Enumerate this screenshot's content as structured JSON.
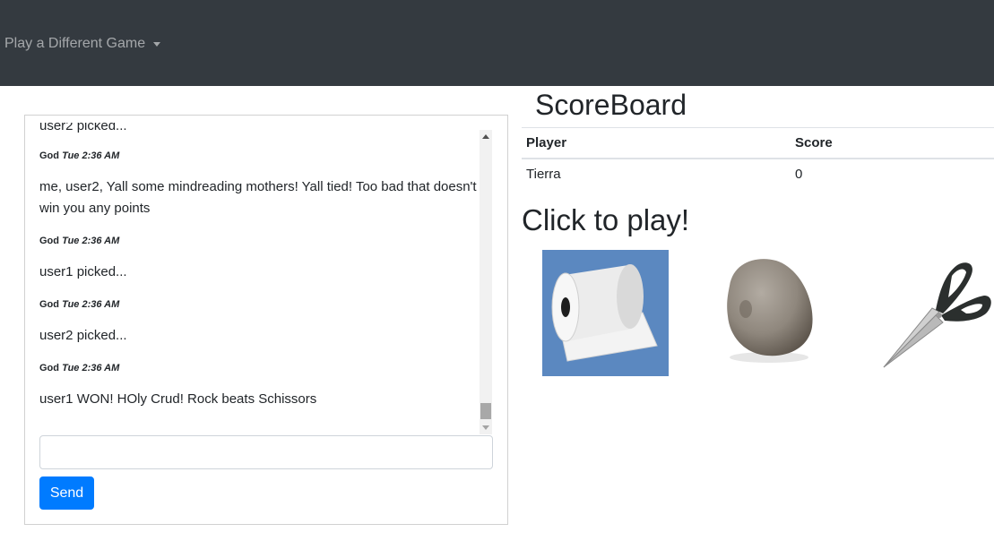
{
  "navbar": {
    "dropdown_label": "Play a Different Game"
  },
  "chat": {
    "messages": [
      {
        "type": "text",
        "text": "user2 picked..."
      },
      {
        "type": "meta",
        "author": "God",
        "time": "Tue 2:36 AM"
      },
      {
        "type": "text",
        "text": "me, user2, Yall some mindreading mothers! Yall tied! Too bad that doesn't win you any points"
      },
      {
        "type": "meta",
        "author": "God",
        "time": "Tue 2:36 AM"
      },
      {
        "type": "text",
        "text": "user1 picked..."
      },
      {
        "type": "meta",
        "author": "God",
        "time": "Tue 2:36 AM"
      },
      {
        "type": "text",
        "text": "user2 picked..."
      },
      {
        "type": "meta",
        "author": "God",
        "time": "Tue 2:36 AM"
      },
      {
        "type": "text",
        "text": "user1 WON! HOly Crud! Rock beats Schissors"
      }
    ],
    "input_value": "",
    "send_label": "Send"
  },
  "scoreboard": {
    "title": "ScoreBoard",
    "headers": [
      "Player",
      "Score"
    ],
    "rows": [
      {
        "player": "Tierra",
        "score": "0"
      }
    ]
  },
  "play": {
    "title": "Click to play!",
    "choices": [
      "paper",
      "rock",
      "scissors"
    ]
  },
  "colors": {
    "navbar_bg": "#343a40",
    "send_button": "#007bff",
    "paper_bg": "#5b88c0"
  }
}
